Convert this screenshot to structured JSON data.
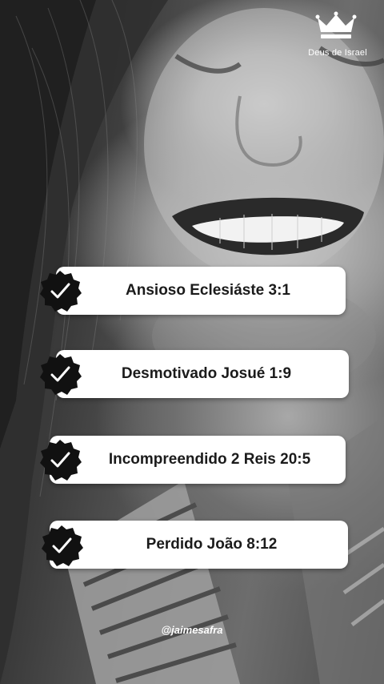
{
  "header": {
    "icon": "crown-icon",
    "brand": "Deus de Israel"
  },
  "items": [
    {
      "label": "Ansioso Eclesiáste 3:1",
      "icon": "verified-check-icon"
    },
    {
      "label": "Desmotivado Josué 1:9",
      "icon": "verified-check-icon"
    },
    {
      "label": "Incompreendido 2 Reis 20:5",
      "icon": "verified-check-icon"
    },
    {
      "label": "Perdido João 8:12",
      "icon": "verified-check-icon"
    }
  ],
  "footer": {
    "handle": "@jaimesafra"
  },
  "colors": {
    "card": "#ffffff",
    "badge": "#111111",
    "text": "#1b1b1b"
  }
}
